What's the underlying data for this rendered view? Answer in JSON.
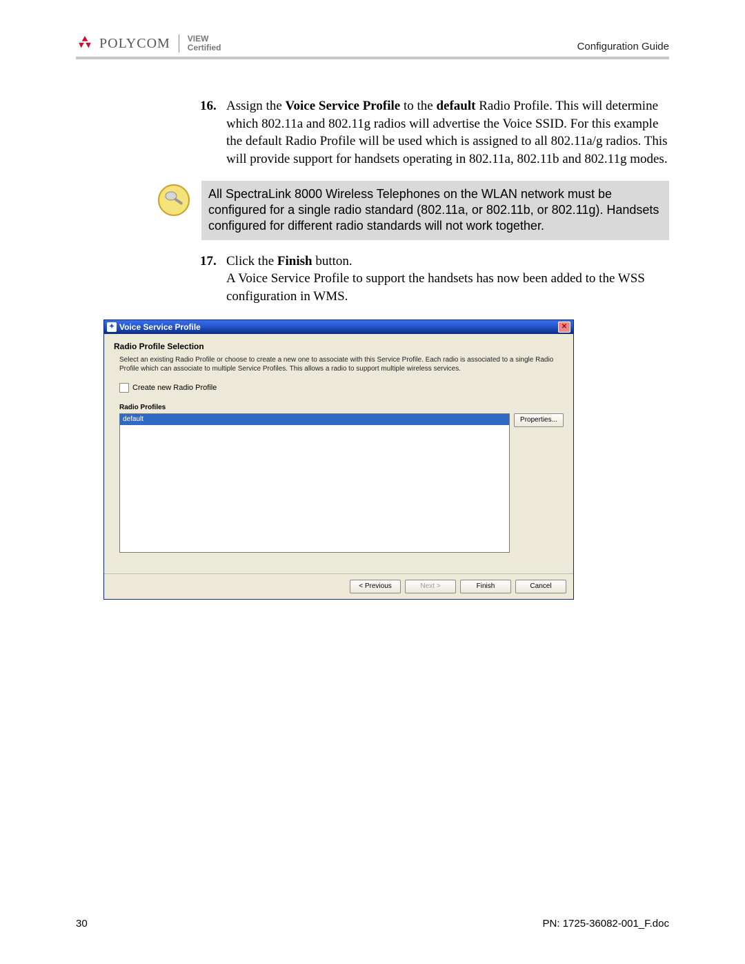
{
  "header": {
    "brand_name": "POLYCOM",
    "brand_tag1": "VIEW",
    "brand_tag2": "Certified",
    "doc_title": "Configuration Guide"
  },
  "steps": {
    "s16": {
      "num": "16.",
      "pre": "Assign the ",
      "bold1": "Voice Service Profile",
      "mid": " to the ",
      "bold2": "default",
      "post": " Radio Profile. This will determine which 802.11a and 802.11g radios will advertise the Voice SSID. For this example the default Radio Profile will be used which is assigned to all 802.11a/g radios. This will provide support for handsets operating in 802.11a, 802.11b and 802.11g modes."
    },
    "s17": {
      "num": "17.",
      "pre": "Click the ",
      "bold1": "Finish",
      "post1": " button.",
      "line2": "A Voice Service Profile to support the handsets has now been added to the WSS configuration in WMS."
    }
  },
  "note": "All SpectraLink 8000 Wireless Telephones on the WLAN network must be configured for a single radio standard (802.11a, or 802.11b, or 802.11g). Handsets configured for different radio standards will not work together.",
  "window": {
    "title": "Voice Service Profile",
    "heading": "Radio Profile Selection",
    "description": "Select an existing Radio Profile or choose to create a new one to associate with this Service Profile. Each radio is associated to a single Radio Profile which can associate to multiple Service Profiles. This allows a radio to support multiple wireless services.",
    "checkbox_label": "Create new Radio Profile",
    "list_label": "Radio Profiles",
    "list_items": [
      "default"
    ],
    "properties_btn": "Properties...",
    "buttons": {
      "previous": "< Previous",
      "next": "Next >",
      "finish": "Finish",
      "cancel": "Cancel"
    }
  },
  "footer": {
    "page": "30",
    "pn": "PN: 1725-36082-001_F.doc"
  }
}
